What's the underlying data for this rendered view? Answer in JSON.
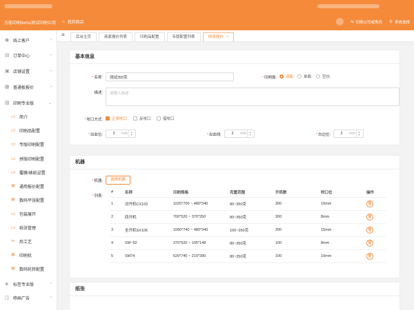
{
  "header": {
    "company": "万能印刷demo测试印刷公司",
    "home_label": "我的商店",
    "switch_label": "切换公司或角色",
    "settings_label": "系统选择"
  },
  "sidebar": {
    "items": [
      {
        "label": "线上客户",
        "icon": "user-icon",
        "chevron": "›"
      },
      {
        "label": "订单中心",
        "icon": "order-icon",
        "chevron": "›"
      },
      {
        "label": "店铺设置",
        "icon": "shop-icon",
        "chevron": "›"
      },
      {
        "label": "普通板报价",
        "icon": "price-icon",
        "chevron": "›"
      },
      {
        "label": "印刷专业版",
        "icon": "print-icon",
        "chevron": "⌄"
      }
    ],
    "sub_items": [
      {
        "label": "简介",
        "icon": "doc-icon"
      },
      {
        "label": "印刷品配置",
        "icon": "doc-icon"
      },
      {
        "label": "专版印刷配置",
        "icon": "doc-icon"
      },
      {
        "label": "拼版印刷配置",
        "icon": "doc-icon"
      },
      {
        "label": "覆膜/裱纸设置",
        "icon": "doc-icon"
      },
      {
        "label": "通用报价配置",
        "icon": "gear-icon"
      },
      {
        "label": "数码平张配置",
        "icon": "gear-icon"
      },
      {
        "label": "包装展开",
        "icon": "doc-icon"
      },
      {
        "label": "纸张管理",
        "icon": "doc-icon"
      },
      {
        "label": "后工艺",
        "icon": "tool-icon"
      },
      {
        "label": "印刷机",
        "icon": "gear-icon"
      },
      {
        "label": "数码轮转配置",
        "icon": "gear-icon"
      }
    ],
    "bottom_items": [
      {
        "label": "标签专业版",
        "icon": "tag-icon",
        "chevron": "›"
      },
      {
        "label": "喷画广告",
        "icon": "ad-icon",
        "chevron": "›"
      }
    ]
  },
  "tabs": {
    "menu_icon": "≡",
    "items": [
      {
        "label": "后台主页",
        "active": false
      },
      {
        "label": "商家报价列表",
        "active": false
      },
      {
        "label": "印刷品配置",
        "active": false
      },
      {
        "label": "专版配置列表",
        "active": false
      },
      {
        "label": "修改报价",
        "active": true
      }
    ],
    "close_glyph": "×"
  },
  "basic": {
    "title": "基本信息",
    "name_label": "名称:",
    "name_value": "测试350克",
    "print_side_label": "印刷面:",
    "print_side_options": [
      "双面",
      "单面",
      "空白"
    ],
    "print_side_selected": 0,
    "desc_label": "描述:",
    "desc_placeholder": "请输入描述",
    "bite_label": "咬口方式:",
    "bite_options": [
      "正常咬口",
      "反咬口",
      "借咬口"
    ],
    "bite_selected": 0,
    "bleed_label": "出血位:",
    "bleed_value": "2",
    "bleed_line_label": "出血线:",
    "bleed_line_value": "2",
    "white_edge_label": "白边位:",
    "white_edge_value": "2",
    "unit": "mm"
  },
  "machine": {
    "title": "机器",
    "machine_label": "机器:",
    "select_button": "选择机器",
    "list_label": "列表:",
    "columns": [
      "#",
      "名称",
      "印刷规格",
      "克重范围",
      "开机数",
      "咬口位",
      "操作"
    ],
    "rows": [
      [
        "1",
        "对开机CX102",
        "1020*700 ~ 480*340",
        "80~350克",
        "300",
        "10mm"
      ],
      [
        "2",
        "四开机",
        "700*520 ~ 370*250",
        "80~350克",
        "300",
        "8mm"
      ],
      [
        "3",
        "全开机SX106",
        "1060*740 ~ 480*340",
        "100~350克",
        "200",
        "15mm"
      ],
      [
        "4",
        "SM~52",
        "370*520 ~ 105*148",
        "80~350克",
        "100",
        "8mm"
      ],
      [
        "5",
        "SM74",
        "520*740 ~ 210*280",
        "80~350克",
        "100",
        "10mm"
      ]
    ],
    "delete_icon": "trash-icon"
  },
  "paper": {
    "title": "纸张"
  },
  "colors": {
    "accent": "#f58a3a"
  }
}
